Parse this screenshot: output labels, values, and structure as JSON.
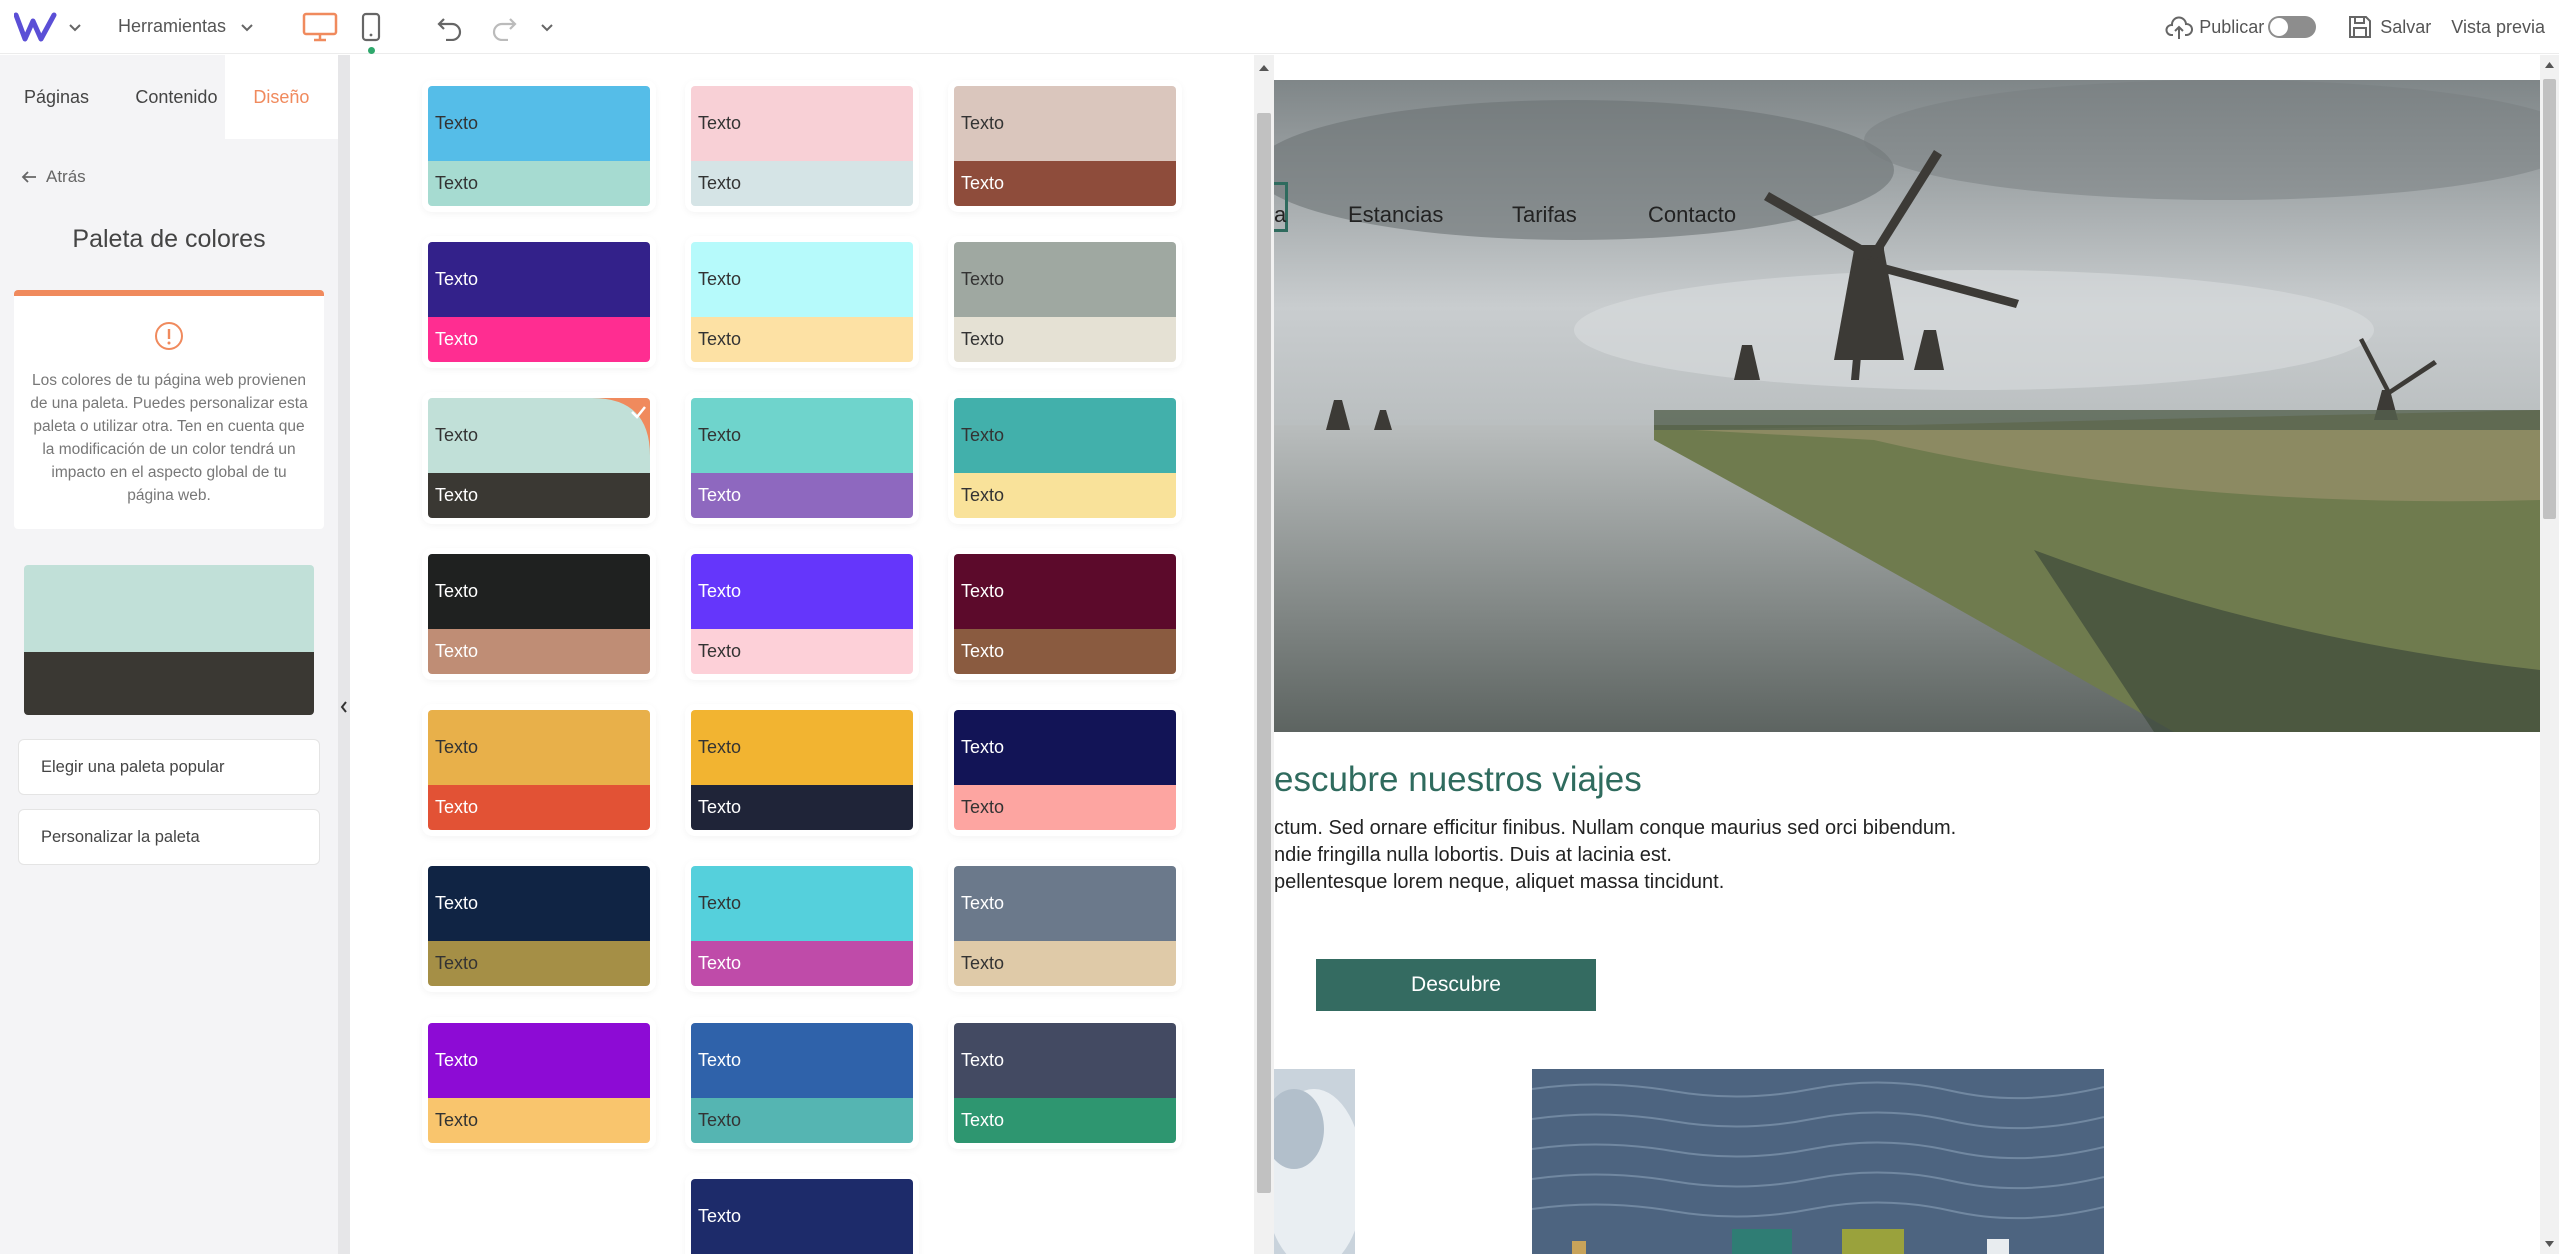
{
  "topbar": {
    "tools_label": "Herramientas",
    "publish_label": "Publicar",
    "save_label": "Salvar",
    "preview_label": "Vista previa"
  },
  "left": {
    "tabs": [
      {
        "label": "Páginas"
      },
      {
        "label": "Contenido"
      },
      {
        "label": "Diseño"
      }
    ],
    "back_label": "Atrás",
    "title": "Paleta de colores",
    "info_text": "Los colores de tu página web provienen de una paleta. Puedes personalizar esta paleta o utilizar otra. Ten en cuenta que la modificación de un color tendrá un impacto en el aspecto global de tu página web.",
    "choose_popular_label": "Elegir una paleta popular",
    "customize_label": "Personalizar la paleta"
  },
  "palettes": {
    "sample_text": "Texto",
    "items": [
      {
        "top": "#55bde8",
        "bottom": "#a6dbd1",
        "top_text": "#333333",
        "bottom_text": "#333333"
      },
      {
        "top": "#f8d0d6",
        "bottom": "#d5e4e6",
        "top_text": "#333333",
        "bottom_text": "#333333"
      },
      {
        "top": "#dac6bd",
        "bottom": "#8e4c3b",
        "top_text": "#333333",
        "bottom_text": "#ffffff"
      },
      {
        "top": "#33218a",
        "bottom": "#ff2d91",
        "top_text": "#ffffff",
        "bottom_text": "#ffffff"
      },
      {
        "top": "#b6fafb",
        "bottom": "#fde1a4",
        "top_text": "#333333",
        "bottom_text": "#333333"
      },
      {
        "top": "#9fa8a1",
        "bottom": "#e5e1d4",
        "top_text": "#333333",
        "bottom_text": "#333333"
      },
      {
        "top": "#c1e0d8",
        "bottom": "#3a3833",
        "top_text": "#333333",
        "bottom_text": "#ffffff",
        "selected": true
      },
      {
        "top": "#6fd4cc",
        "bottom": "#8e68bf",
        "top_text": "#333333",
        "bottom_text": "#ffffff"
      },
      {
        "top": "#42b0ab",
        "bottom": "#f9e29a",
        "top_text": "#333333",
        "bottom_text": "#333333"
      },
      {
        "top": "#1f2120",
        "bottom": "#bf8d75",
        "top_text": "#ffffff",
        "bottom_text": "#ffffff"
      },
      {
        "top": "#6536fb",
        "bottom": "#fdd0d8",
        "top_text": "#ffffff",
        "bottom_text": "#333333"
      },
      {
        "top": "#5c0a2b",
        "bottom": "#8a5b40",
        "top_text": "#ffffff",
        "bottom_text": "#ffffff"
      },
      {
        "top": "#e8b04a",
        "bottom": "#e25235",
        "top_text": "#333333",
        "bottom_text": "#ffffff"
      },
      {
        "top": "#f2b431",
        "bottom": "#1f2438",
        "top_text": "#333333",
        "bottom_text": "#ffffff"
      },
      {
        "top": "#121456",
        "bottom": "#fda5a1",
        "top_text": "#ffffff",
        "bottom_text": "#333333"
      },
      {
        "top": "#102444",
        "bottom": "#a58f46",
        "top_text": "#ffffff",
        "bottom_text": "#333333"
      },
      {
        "top": "#55d0dc",
        "bottom": "#bf4ba9",
        "top_text": "#333333",
        "bottom_text": "#ffffff"
      },
      {
        "top": "#6b798b",
        "bottom": "#dfcaa8",
        "top_text": "#ffffff",
        "bottom_text": "#333333"
      },
      {
        "top": "#8d0bd5",
        "bottom": "#f9c56d",
        "top_text": "#ffffff",
        "bottom_text": "#333333"
      },
      {
        "top": "#2f62aa",
        "bottom": "#55b5b2",
        "top_text": "#ffffff",
        "bottom_text": "#333333"
      },
      {
        "top": "#434a62",
        "bottom": "#2e9670",
        "top_text": "#ffffff",
        "bottom_text": "#ffffff"
      },
      {
        "top": "#1d2b6a",
        "bottom": "#1d2b6a",
        "top_text": "#ffffff",
        "bottom_text": "#ffffff"
      }
    ]
  },
  "site": {
    "nav": [
      "a",
      "Estancias",
      "Tarifas",
      "Contacto"
    ],
    "section_title": "escubre nuestros viajes",
    "lines": [
      "ctum. Sed ornare efficitur finibus. Nullam conque maurius sed orci bibendum.",
      "ndie fringilla nulla lobortis. Duis at lacinia est.",
      "pellentesque lorem neque, aliquet massa tincidunt."
    ],
    "cta_label": "Descubre"
  },
  "colors": {
    "accent": "#f08a5d",
    "site_primary": "#346b61"
  }
}
